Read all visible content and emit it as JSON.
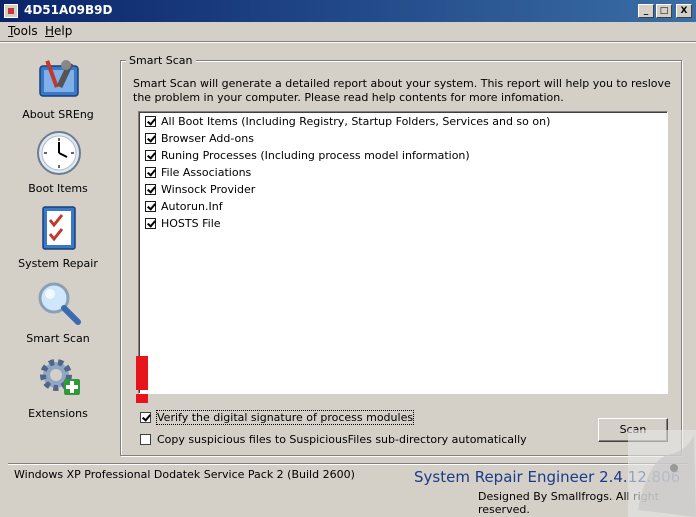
{
  "window": {
    "title": "4D51A09B9D",
    "minimize": "_",
    "maximize": "□",
    "close": "X"
  },
  "menu": {
    "tools": "Tools",
    "tools_key": "T",
    "tools_rest": "ools",
    "help": "Help",
    "help_key": "H",
    "help_rest": "elp"
  },
  "sidebar": {
    "items": [
      {
        "label": "About SREng",
        "icon": "toolbox-icon"
      },
      {
        "label": "Boot Items",
        "icon": "clock-icon"
      },
      {
        "label": "System Repair",
        "icon": "checklist-icon"
      },
      {
        "label": "Smart Scan",
        "icon": "magnifier-icon"
      },
      {
        "label": "Extensions",
        "icon": "gear-plus-icon"
      }
    ]
  },
  "smart_scan": {
    "group_title": "Smart Scan",
    "description": "Smart Scan will generate a detailed report about your system. This report will help you to reslove the problem in your computer. Please read help contents for more infomation.",
    "items": [
      {
        "label": "All Boot Items (Including Registry, Startup Folders, Services and so on)",
        "checked": true
      },
      {
        "label": "Browser Add-ons",
        "checked": true
      },
      {
        "label": "Runing Processes (Including process model information)",
        "checked": true
      },
      {
        "label": "File Associations",
        "checked": true
      },
      {
        "label": "Winsock Provider",
        "checked": true
      },
      {
        "label": "Autorun.Inf",
        "checked": true
      },
      {
        "label": "HOSTS File",
        "checked": true
      }
    ],
    "verify_signature": {
      "label": "Verify the digital signature of process modules",
      "checked": true
    },
    "copy_suspicious": {
      "label": "Copy suspicious files to SuspiciousFiles sub-directory automatically",
      "checked": false
    },
    "scan_button": "Scan"
  },
  "status": {
    "os": "Windows XP Professional Dodatek Service Pack 2 (Build 2600)",
    "product": "System Repair Engineer 2.4.12.806",
    "credit": "Designed By Smallfrogs. All right reserved."
  },
  "colors": {
    "title_bar": "#0a246a",
    "brand_text": "#1a3a8a",
    "alert_mark": "#e8141c",
    "face": "#d4d0c8"
  }
}
